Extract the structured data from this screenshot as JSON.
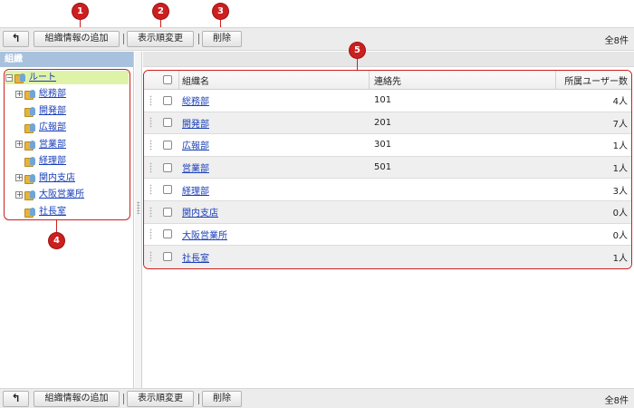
{
  "toolbar": {
    "back_icon": "undo-arrow-icon",
    "add_org_label": "組織情報の追加",
    "reorder_label": "表示順変更",
    "delete_label": "削除",
    "count_label": "全8件"
  },
  "annotations": [
    "1",
    "2",
    "3",
    "4",
    "5"
  ],
  "left_panel": {
    "header": "組織",
    "tree": [
      {
        "label": "ルート",
        "expander": "minus",
        "icon": "organization-icon"
      },
      {
        "label": "総務部",
        "expander": "plus",
        "icon": "organization-icon"
      },
      {
        "label": "開発部",
        "expander": "none",
        "icon": "organization-icon"
      },
      {
        "label": "広報部",
        "expander": "none",
        "icon": "organization-icon"
      },
      {
        "label": "営業部",
        "expander": "plus",
        "icon": "organization-icon"
      },
      {
        "label": "経理部",
        "expander": "none",
        "icon": "organization-icon"
      },
      {
        "label": "関内支店",
        "expander": "plus",
        "icon": "organization-icon"
      },
      {
        "label": "大阪営業所",
        "expander": "plus",
        "icon": "organization-icon"
      },
      {
        "label": "社長室",
        "expander": "none",
        "icon": "organization-icon"
      }
    ]
  },
  "table": {
    "columns": [
      "組織名",
      "連絡先",
      "所属ユーザー数"
    ],
    "rows": [
      {
        "name": "総務部",
        "contact": "101",
        "users": "4人"
      },
      {
        "name": "開発部",
        "contact": "201",
        "users": "7人"
      },
      {
        "name": "広報部",
        "contact": "301",
        "users": "1人"
      },
      {
        "name": "営業部",
        "contact": "501",
        "users": "1人"
      },
      {
        "name": "経理部",
        "contact": "",
        "users": "3人"
      },
      {
        "name": "関内支店",
        "contact": "",
        "users": "0人"
      },
      {
        "name": "大阪営業所",
        "contact": "",
        "users": "0人"
      },
      {
        "name": "社長室",
        "contact": "",
        "users": "1人"
      }
    ]
  },
  "colors": {
    "annotation": "#cc1f1f",
    "link": "#1a3fb8",
    "panel_header": "#a8c2dd",
    "root_highlight": "#dff3a8"
  }
}
